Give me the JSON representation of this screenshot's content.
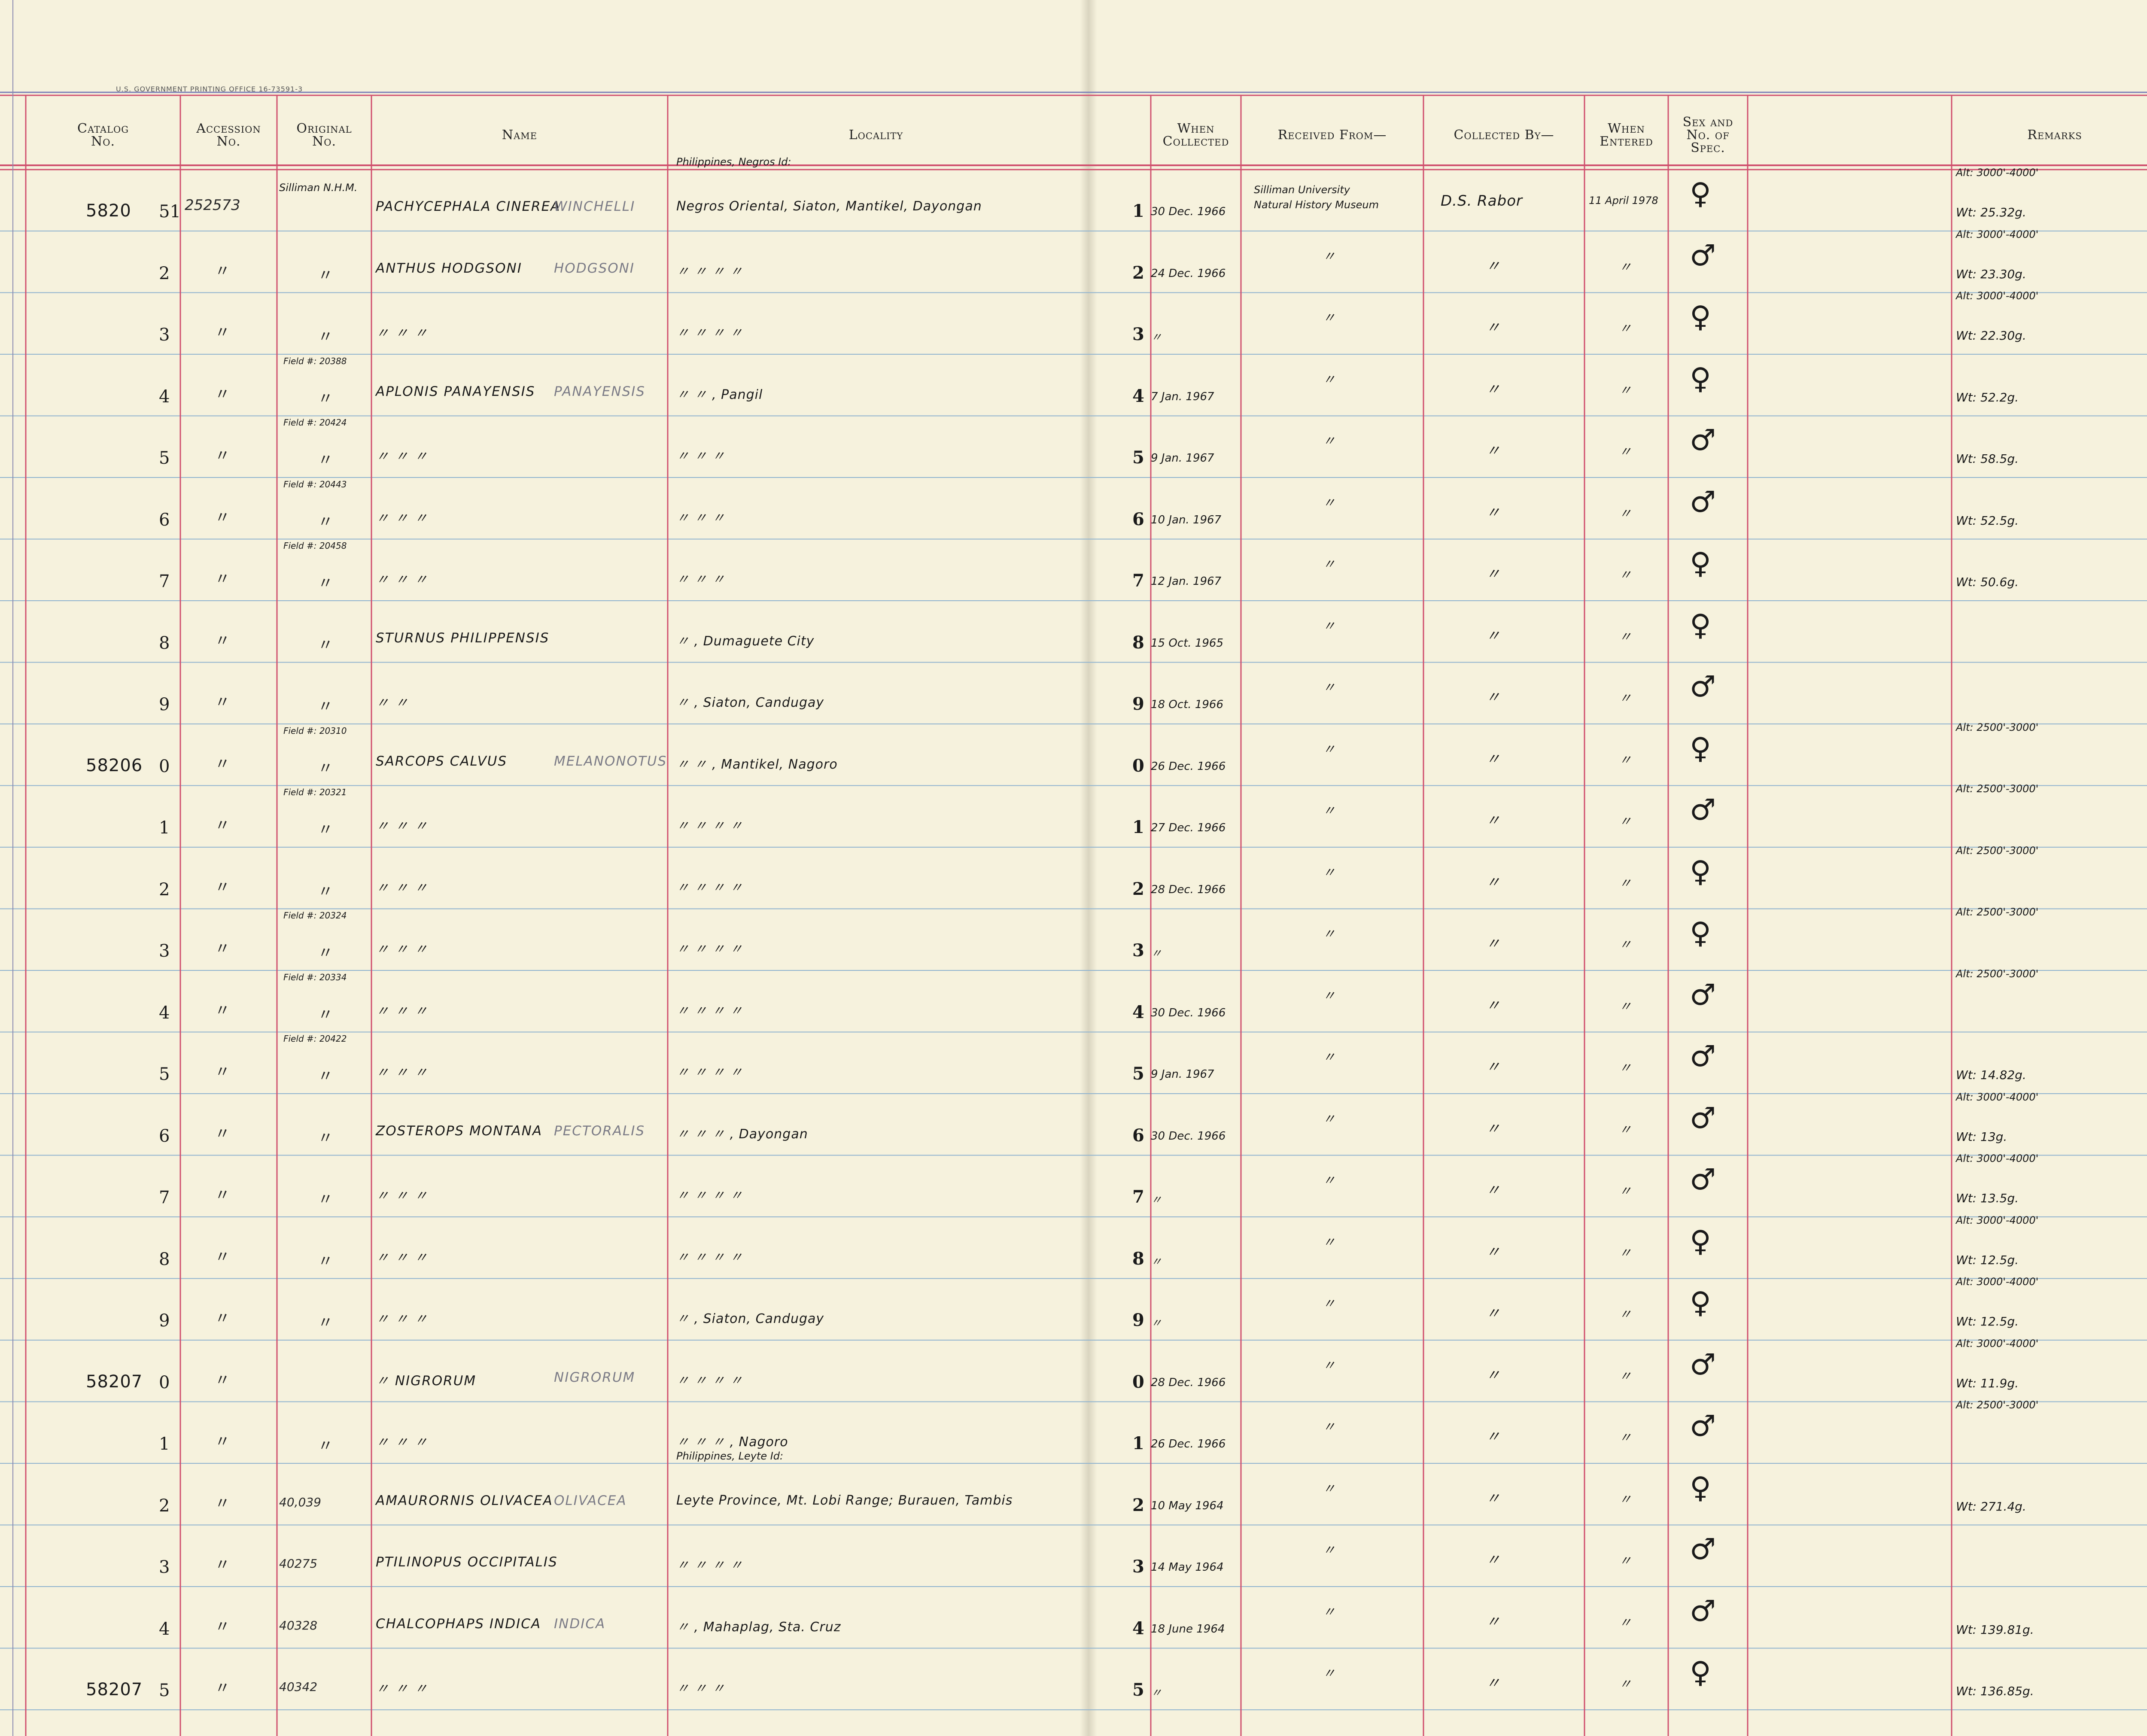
{
  "header": {
    "imprint": "U.S. GOVERNMENT PRINTING OFFICE  16-73591-3",
    "columns": {
      "catalog": "Catalog\nNo.",
      "accession": "Accession\nNo.",
      "original": "Original\nNo.",
      "name": "Name",
      "locality": "Locality",
      "when_collected": "When\nCollected",
      "received_from": "Received From—",
      "collected_by": "Collected By—",
      "when_entered": "When\nEntered",
      "sex": "Sex and\nNo. of\nSpec.",
      "remarks": "Remarks"
    }
  },
  "rows": [
    {
      "cat_prefix": "5820",
      "cat_digit": "51",
      "accession": "252573",
      "original": "Silliman N.H.M.",
      "original_above": "",
      "name": "Pachycephala cinerea",
      "name_ssp": "winchelli",
      "locality_above": "Philippines, Negros Id:",
      "locality": "Negros Oriental, Siaton, Mantikel, Dayongan",
      "day": "1",
      "date": "30 Dec. 1966",
      "received": "Silliman University",
      "received2": "Natural History Museum",
      "collector": "D.S. Rabor",
      "entered": "11 April 1978",
      "sex": "♀",
      "remark_alt": "Alt: 3000'-4000'",
      "remark_wt": "Wt: 25.32g."
    },
    {
      "cat_digit": "2",
      "accession": "〃",
      "original": "〃",
      "name": "Anthus hodgsoni",
      "name_ssp": "hodgsoni",
      "locality": "〃    〃    〃    〃",
      "day": "2",
      "date": "24 Dec. 1966",
      "received": "〃",
      "collector": "〃",
      "entered": "〃",
      "sex": "♂",
      "remark_alt": "Alt: 3000'-4000'",
      "remark_wt": "Wt: 23.30g."
    },
    {
      "cat_digit": "3",
      "accession": "〃",
      "original": "〃",
      "name": "〃      〃      〃",
      "name_ssp": "",
      "locality": "〃    〃    〃    〃",
      "day": "3",
      "date": "〃",
      "received": "〃",
      "collector": "〃",
      "entered": "〃",
      "sex": "♀",
      "remark_alt": "Alt: 3000'-4000'",
      "remark_wt": "Wt: 22.30g."
    },
    {
      "cat_digit": "4",
      "accession": "〃",
      "original": "〃",
      "original_above": "Field #: 20388",
      "name": "Aplonis panayensis",
      "name_ssp": "panayensis",
      "locality": "〃    〃  , Pangil",
      "day": "4",
      "date": "7 Jan. 1967",
      "received": "〃",
      "collector": "〃",
      "entered": "〃",
      "sex": "♀",
      "remark_alt": "",
      "remark_wt": "Wt: 52.2g."
    },
    {
      "cat_digit": "5",
      "accession": "〃",
      "original": "〃",
      "original_above": "Field #: 20424",
      "name": "〃      〃      〃",
      "name_ssp": "",
      "locality": "〃    〃    〃",
      "day": "5",
      "date": "9 Jan. 1967",
      "received": "〃",
      "collector": "〃",
      "entered": "〃",
      "sex": "♂",
      "remark_alt": "",
      "remark_wt": "Wt: 58.5g."
    },
    {
      "cat_digit": "6",
      "accession": "〃",
      "original": "〃",
      "original_above": "Field #: 20443",
      "name": "〃      〃      〃",
      "name_ssp": "",
      "locality": "〃    〃    〃",
      "day": "6",
      "date": "10 Jan. 1967",
      "received": "〃",
      "collector": "〃",
      "entered": "〃",
      "sex": "♂",
      "remark_alt": "",
      "remark_wt": "Wt: 52.5g."
    },
    {
      "cat_digit": "7",
      "accession": "〃",
      "original": "〃",
      "original_above": "Field #: 20458",
      "name": "〃      〃      〃",
      "name_ssp": "",
      "locality": "〃    〃    〃",
      "day": "7",
      "date": "12 Jan. 1967",
      "received": "〃",
      "collector": "〃",
      "entered": "〃",
      "sex": "♀",
      "remark_alt": "",
      "remark_wt": "Wt: 50.6g."
    },
    {
      "cat_digit": "8",
      "accession": "〃",
      "original": "〃",
      "name": "Sturnus philippensis",
      "name_ssp": "",
      "locality": "〃  , Dumaguete City",
      "day": "8",
      "date": "15 Oct. 1965",
      "received": "〃",
      "collector": "〃",
      "entered": "〃",
      "sex": "♀",
      "remark_alt": "",
      "remark_wt": ""
    },
    {
      "cat_digit": "9",
      "accession": "〃",
      "original": "〃",
      "name": "〃      〃",
      "name_ssp": "",
      "locality": "〃  , Siaton, Candugay",
      "day": "9",
      "date": "18 Oct. 1966",
      "received": "〃",
      "collector": "〃",
      "entered": "〃",
      "sex": "♂",
      "remark_alt": "",
      "remark_wt": ""
    },
    {
      "cat_prefix": "58206",
      "cat_digit": "0",
      "accession": "〃",
      "original": "〃",
      "original_above": "Field #: 20310",
      "name": "Sarcops calvus",
      "name_ssp": "melanonotus",
      "locality": "〃    〃  , Mantikel, Nagoro",
      "day": "0",
      "date": "26 Dec. 1966",
      "received": "〃",
      "collector": "〃",
      "entered": "〃",
      "sex": "♀",
      "remark_alt": "Alt: 2500'-3000'",
      "remark_wt": ""
    },
    {
      "cat_digit": "1",
      "accession": "〃",
      "original": "〃",
      "original_above": "Field #: 20321",
      "name": "〃      〃      〃",
      "name_ssp": "",
      "locality": "〃    〃    〃    〃",
      "day": "1",
      "date": "27 Dec. 1966",
      "received": "〃",
      "collector": "〃",
      "entered": "〃",
      "sex": "♂",
      "remark_alt": "Alt: 2500'-3000'",
      "remark_wt": ""
    },
    {
      "cat_digit": "2",
      "accession": "〃",
      "original": "〃",
      "name": "〃      〃      〃",
      "name_ssp": "",
      "locality": "〃    〃    〃    〃",
      "day": "2",
      "date": "28 Dec. 1966",
      "received": "〃",
      "collector": "〃",
      "entered": "〃",
      "sex": "♀",
      "remark_alt": "Alt: 2500'-3000'",
      "remark_wt": ""
    },
    {
      "cat_digit": "3",
      "accession": "〃",
      "original": "〃",
      "original_above": "Field #: 20324",
      "name": "〃      〃      〃",
      "name_ssp": "",
      "locality": "〃    〃    〃    〃",
      "day": "3",
      "date": "〃",
      "received": "〃",
      "collector": "〃",
      "entered": "〃",
      "sex": "♀",
      "remark_alt": "Alt: 2500'-3000'",
      "remark_wt": ""
    },
    {
      "cat_digit": "4",
      "accession": "〃",
      "original": "〃",
      "original_above": "Field #: 20334",
      "name": "〃      〃      〃",
      "name_ssp": "",
      "locality": "〃    〃    〃    〃",
      "day": "4",
      "date": "30 Dec. 1966",
      "received": "〃",
      "collector": "〃",
      "entered": "〃",
      "sex": "♂",
      "remark_alt": "Alt: 2500'-3000'",
      "remark_wt": ""
    },
    {
      "cat_digit": "5",
      "accession": "〃",
      "original": "〃",
      "original_above": "Field #: 20422",
      "name": "〃      〃      〃",
      "name_ssp": "",
      "locality": "〃    〃    〃    〃",
      "day": "5",
      "date": "9 Jan. 1967",
      "received": "〃",
      "collector": "〃",
      "entered": "〃",
      "sex": "♂",
      "remark_alt": "",
      "remark_wt": "Wt: 14.82g."
    },
    {
      "cat_digit": "6",
      "accession": "〃",
      "original": "〃",
      "name": "Zosterops montana",
      "name_ssp": "pectoralis",
      "locality": "〃    〃    〃  , Dayongan",
      "day": "6",
      "date": "30 Dec. 1966",
      "received": "〃",
      "collector": "〃",
      "entered": "〃",
      "sex": "♂",
      "remark_alt": "Alt: 3000'-4000'",
      "remark_wt": "Wt: 13g."
    },
    {
      "cat_digit": "7",
      "accession": "〃",
      "original": "〃",
      "name": "〃      〃      〃",
      "name_ssp": "",
      "locality": "〃    〃    〃    〃",
      "day": "7",
      "date": "〃",
      "received": "〃",
      "collector": "〃",
      "entered": "〃",
      "sex": "♂",
      "remark_alt": "Alt: 3000'-4000'",
      "remark_wt": "Wt: 13.5g."
    },
    {
      "cat_digit": "8",
      "accession": "〃",
      "original": "〃",
      "name": "〃      〃      〃",
      "name_ssp": "",
      "locality": "〃    〃    〃    〃",
      "day": "8",
      "date": "〃",
      "received": "〃",
      "collector": "〃",
      "entered": "〃",
      "sex": "♀",
      "remark_alt": "Alt: 3000'-4000'",
      "remark_wt": "Wt: 12.5g."
    },
    {
      "cat_digit": "9",
      "accession": "〃",
      "original": "〃",
      "name": "〃      〃      〃",
      "name_ssp": "",
      "locality": "〃  , Siaton, Candugay",
      "day": "9",
      "date": "〃",
      "received": "〃",
      "collector": "〃",
      "entered": "〃",
      "sex": "♀",
      "remark_alt": "Alt: 3000'-4000'",
      "remark_wt": "Wt: 12.5g."
    },
    {
      "cat_prefix": "58207",
      "cat_digit": "0",
      "accession": "〃",
      "original": "",
      "name": "〃        nigrorum",
      "name_ssp": "nigrorum",
      "locality": "〃    〃    〃    〃",
      "day": "0",
      "date": "28 Dec. 1966",
      "received": "〃",
      "collector": "〃",
      "entered": "〃",
      "sex": "♂",
      "remark_alt": "Alt: 3000'-4000'",
      "remark_wt": "Wt: 11.9g."
    },
    {
      "cat_digit": "1",
      "accession": "〃",
      "original": "〃",
      "name": "〃      〃      〃",
      "name_ssp": "",
      "locality": "〃    〃    〃  , Nagoro",
      "day": "1",
      "date": "26 Dec. 1966",
      "received": "〃",
      "collector": "〃",
      "entered": "〃",
      "sex": "♂",
      "remark_alt": "Alt: 2500'-3000'",
      "remark_wt": ""
    },
    {
      "cat_digit": "2",
      "accession": "〃",
      "original": "40,039",
      "name": "Amaurornis olivacea",
      "name_ssp": "olivacea",
      "locality_above": "Philippines, Leyte Id:",
      "locality": "Leyte Province, Mt. Lobi Range; Burauen, Tambis",
      "day": "2",
      "date": "10 May 1964",
      "received": "〃",
      "collector": "〃",
      "entered": "〃",
      "sex": "♀",
      "remark_alt": "",
      "remark_wt": "Wt: 271.4g."
    },
    {
      "cat_digit": "3",
      "accession": "〃",
      "original": "40275",
      "name": "Ptilinopus occipitalis",
      "name_ssp": "",
      "locality": "〃    〃    〃    〃",
      "day": "3",
      "date": "14 May 1964",
      "received": "〃",
      "collector": "〃",
      "entered": "〃",
      "sex": "♂",
      "remark_alt": "",
      "remark_wt": ""
    },
    {
      "cat_digit": "4",
      "accession": "〃",
      "original": "40328",
      "name": "Chalcophaps indica",
      "name_ssp": "indica",
      "locality": "〃  , Mahaplag, Sta. Cruz",
      "day": "4",
      "date": "18 June 1964",
      "received": "〃",
      "collector": "〃",
      "entered": "〃",
      "sex": "♂",
      "remark_alt": "",
      "remark_wt": "Wt: 139.81g."
    },
    {
      "cat_prefix": "58207",
      "cat_digit": "5",
      "accession": "〃",
      "original": "40342",
      "name": "〃      〃      〃",
      "name_ssp": "",
      "locality": "〃    〃    〃",
      "day": "5",
      "date": "〃",
      "received": "〃",
      "collector": "〃",
      "entered": "〃",
      "sex": "♀",
      "remark_alt": "",
      "remark_wt": "Wt: 136.85g."
    }
  ],
  "colors": {
    "paper": "#f6f2dd",
    "rule_blue": "#8fb3cf",
    "rule_red": "#d0506e",
    "ink": "#1d1d1d",
    "pencil": "#7b7b86"
  }
}
